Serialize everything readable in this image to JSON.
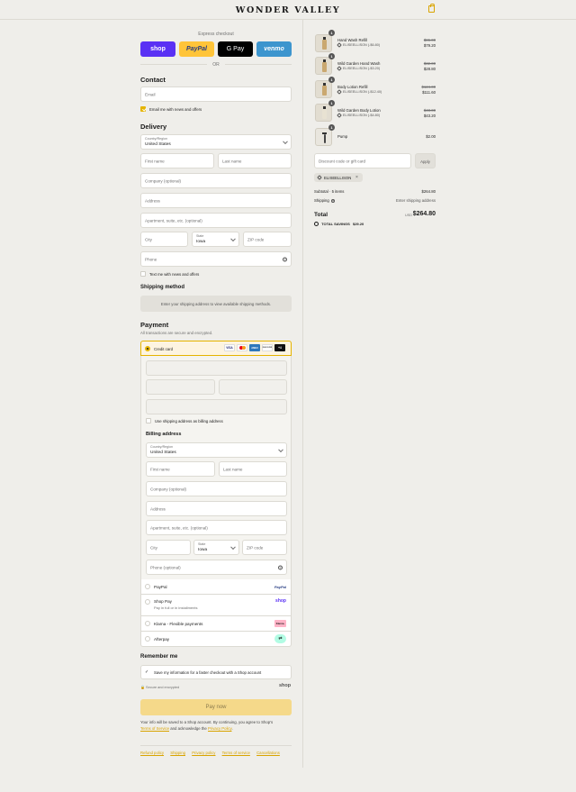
{
  "header": {
    "brand": "WONDER VALLEY",
    "cart_icon": "shopping-bag-icon",
    "accent": "#e5b400"
  },
  "express": {
    "label": "Express checkout",
    "buttons": [
      {
        "label": "shop",
        "color": "#5a31f4"
      },
      {
        "label": "PayPal",
        "color": "#ffc439"
      },
      {
        "label": "G Pay",
        "color": "#000000"
      },
      {
        "label": "venmo",
        "color": "#3d95ce"
      }
    ],
    "or": "OR"
  },
  "contact": {
    "heading": "Contact",
    "email_placeholder": "Email",
    "news_label": "Email me with news and offers",
    "news_checked": true
  },
  "delivery": {
    "heading": "Delivery",
    "country_label": "Country/Region",
    "country_value": "United States",
    "first_name": "First name",
    "last_name": "Last name",
    "company": "Company (optional)",
    "address": "Address",
    "apartment": "Apartment, suite, etc. (optional)",
    "city": "City",
    "state_label": "State",
    "state_value": "Iowa",
    "zip": "ZIP code",
    "phone": "Phone",
    "text_label": "Text me with news and offers"
  },
  "shipping_method": {
    "heading": "Shipping method",
    "notice": "Enter your shipping address to view available shipping methods."
  },
  "payment": {
    "heading": "Payment",
    "subtitle": "All transactions are secure and encrypted.",
    "credit_card_label": "Credit card",
    "card_brands": [
      "VISA",
      "MC",
      "AMEX",
      "DISCOVER",
      "+4"
    ],
    "billing_same_label": "Use shipping address as billing address",
    "billing": {
      "heading": "Billing address",
      "country_label": "Country/Region",
      "country_value": "United States",
      "first_name": "First name",
      "last_name": "Last name",
      "company": "Company (optional)",
      "address": "Address",
      "apartment": "Apartment, suite, etc. (optional)",
      "city": "City",
      "state_label": "State",
      "state_value": "Iowa",
      "zip": "ZIP code",
      "phone": "Phone (optional)"
    },
    "methods": [
      {
        "label": "PayPal",
        "sub": "",
        "badge": "PayPal"
      },
      {
        "label": "Shop Pay",
        "sub": "Pay in full or in installments",
        "badge": "shop"
      },
      {
        "label": "Klarna - Flexible payments",
        "sub": "",
        "badge": "Klarna."
      },
      {
        "label": "Afterpay",
        "sub": "",
        "badge": "afterpay-icon"
      }
    ]
  },
  "remember": {
    "heading": "Remember me",
    "save_label": "Save my information for a faster checkout with a Shop account",
    "secure": "Secure and encrypted",
    "shop_logo": "shop"
  },
  "pay_button": "Pay now",
  "legal": {
    "text1": "Your info will be saved to a Shop account. By continuing, you agree to Shop's",
    "terms": "Terms of Service",
    "text2": "and acknowledge the",
    "privacy": "Privacy Policy",
    "end": "."
  },
  "footer_links": [
    "Refund policy",
    "Shipping",
    "Privacy policy",
    "Terms of service",
    "Cancellations"
  ],
  "order": {
    "items": [
      {
        "name": "Hand Wash Refill",
        "discount": "ELISEELLISON (-$6.80)",
        "old_price": "$86.00",
        "price": "$79.20",
        "qty": "1"
      },
      {
        "name": "Wild Garden Hand Wash",
        "discount": "ELISEELLISON (-$3.20)",
        "old_price": "$32.00",
        "price": "$28.80",
        "qty": "1"
      },
      {
        "name": "Body Lotion Refill",
        "discount": "ELISEELLISON (-$12.40)",
        "old_price": "$124.00",
        "price": "$111.60",
        "qty": "1"
      },
      {
        "name": "Wild Garden Body Lotion",
        "discount": "ELISEELLISON (-$4.80)",
        "old_price": "$48.00",
        "price": "$43.20",
        "qty": "1"
      },
      {
        "name": "Pump",
        "discount": "",
        "old_price": "",
        "price": "$2.00",
        "qty": "1"
      }
    ],
    "discount_placeholder": "Discount code or gift card",
    "apply": "Apply",
    "applied_code": "ELISEELLISON",
    "subtotal_label": "Subtotal · 5 items",
    "subtotal_value": "$264.80",
    "shipping_label": "Shipping",
    "shipping_value": "Enter shipping address",
    "total_label": "Total",
    "currency": "USD",
    "total_value": "$264.80",
    "savings_label": "TOTAL SAVINGS",
    "savings_value": "$29.20"
  }
}
